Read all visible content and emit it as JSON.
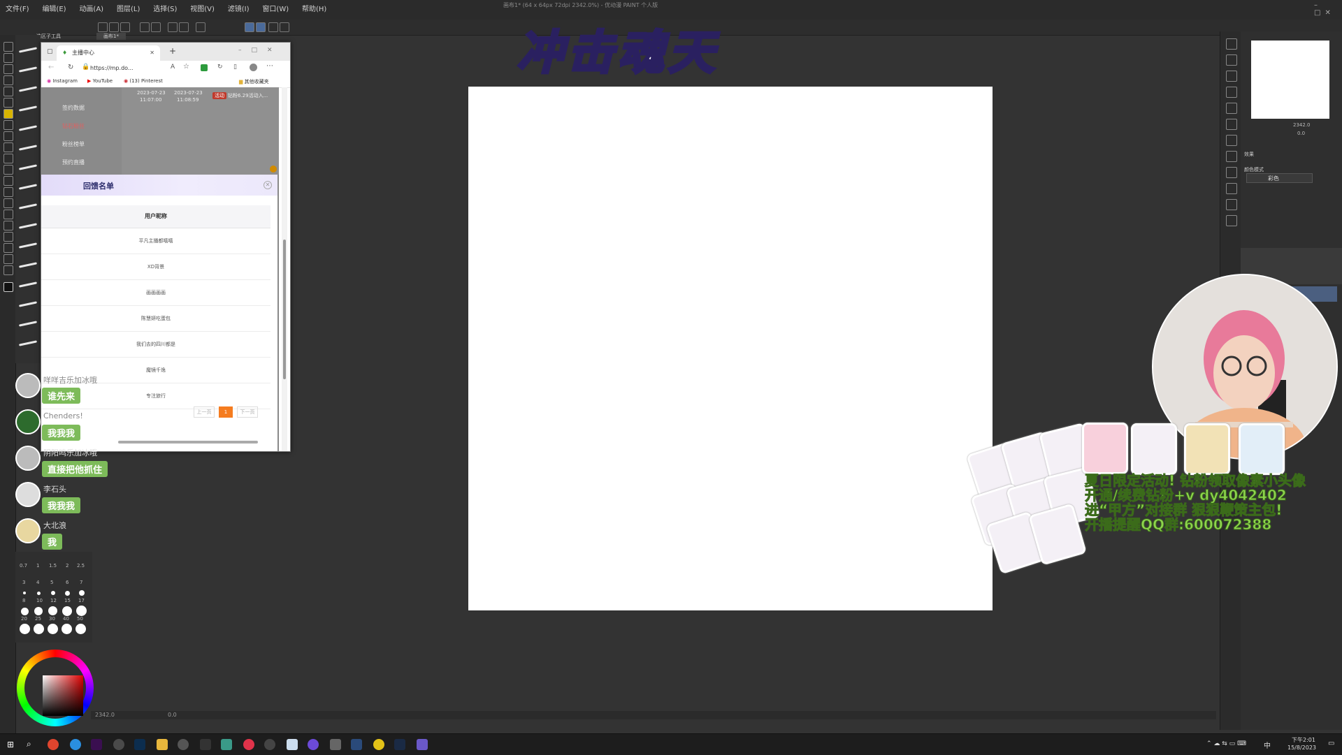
{
  "app": {
    "title_bar": "画布1* (64 x 64px 72dpi 2342.0%) - 优动漫 PAINT 个人版",
    "menu": [
      "文件(F)",
      "编辑(E)",
      "动画(A)",
      "图层(L)",
      "选择(S)",
      "视图(V)",
      "滤镜(I)",
      "窗口(W)",
      "帮助(H)"
    ],
    "tool_tab": "选区子工具",
    "doc_tab": "画布1*",
    "status_zoom": "2342.0",
    "status_angle": "0.0",
    "navigator_zoom": "2342.0",
    "navigator_angle": "0.0",
    "color_mode_label": "颜色模式",
    "color_mode_value": "彩色",
    "effect_label": "效果"
  },
  "overlay_title": "冲击魂天",
  "browser": {
    "tab_title": "主播中心",
    "url": "https://mp.do...",
    "bookmarks": [
      "Instagram",
      "YouTube",
      "(13) Pinterest",
      "其他收藏夹"
    ],
    "sidebar_items": [
      "签约数据",
      "钻石粉丝",
      "粉丝榜单",
      "预约直播"
    ],
    "top_data": {
      "date1": "2023-07-23",
      "time1": "11:07:00",
      "date2": "2023-07-23",
      "time2": "11:08:59",
      "badge": "活动",
      "note": "钻粉6.29活动入..."
    },
    "modal": {
      "title": "回馈名单",
      "column": "用户昵称",
      "rows": [
        "平凡主播都嘻嘻",
        "XD背景",
        "画画画画",
        "陈慧妍吃蛋包",
        "我们去的四川都是",
        "魔镜千逸",
        "专注旅行"
      ],
      "prev": "上一页",
      "page": "1",
      "next": "下一页"
    }
  },
  "chat": [
    {
      "name": "咩咩吉乐加冰哦",
      "message": "谁先来"
    },
    {
      "name": "Chenders!",
      "message": "我我我"
    },
    {
      "name": "阴阳鸣乐加冰哦",
      "message": "直接把他抓住"
    },
    {
      "name": "李石头",
      "message": "我我我"
    },
    {
      "name": "大北浪",
      "message": "我"
    }
  ],
  "brush_sizes": [
    "0.7",
    "1",
    "1.5",
    "2",
    "2.5",
    "3",
    "4",
    "5",
    "6",
    "7",
    "8",
    "10",
    "12",
    "15",
    "17",
    "20",
    "25",
    "30",
    "40",
    "50"
  ],
  "promo_lines": [
    "夏日限定活动! 钻粉领取像素小头像",
    "开通/续费钻粉+v dy4042402",
    "进“甲方”对接群 狠狠鞭策主包!",
    "开播提醒QQ群:600072388"
  ],
  "taskbar": {
    "time": "下午2:01",
    "date": "15/8/2023",
    "ime": "中"
  },
  "colors": {
    "chat_bubble": "#7dbb5a",
    "promo_text": "#8ed44e",
    "pager_active": "#f57c1f",
    "canvas": "#ffffff",
    "workspace": "#333333"
  }
}
